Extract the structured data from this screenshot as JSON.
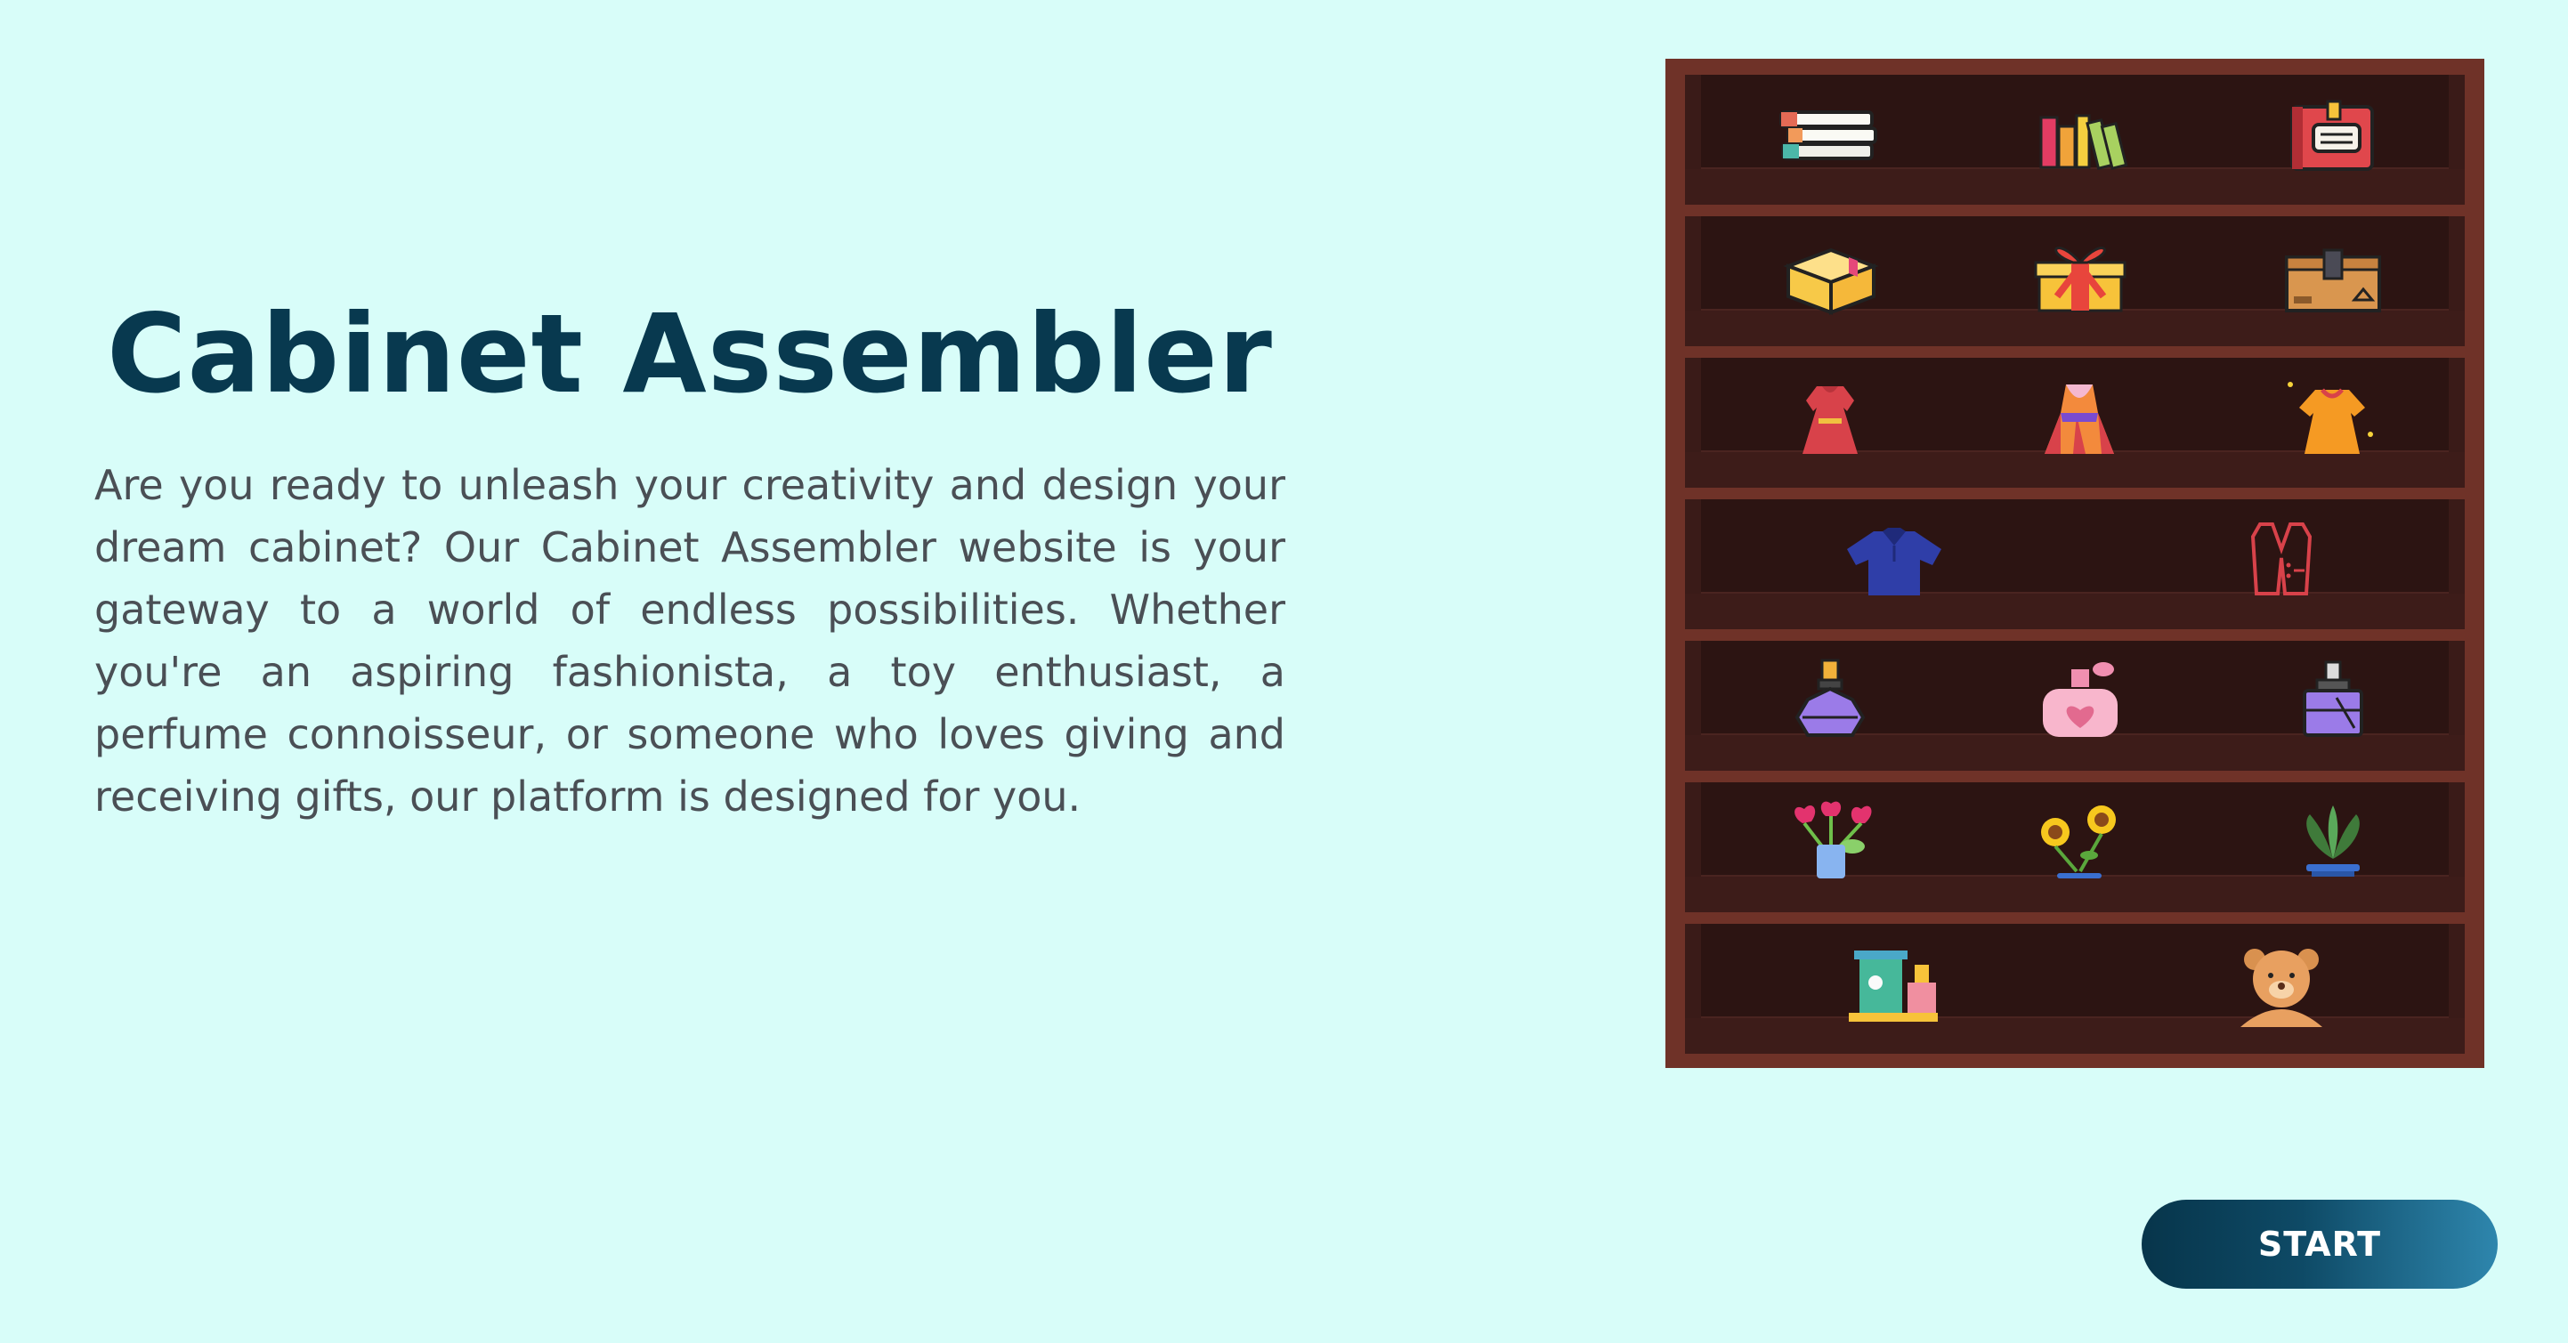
{
  "hero": {
    "title": "Cabinet Assembler",
    "description": "Are you ready to unleash your creativity and design your dream cabinet? Our Cabinet Assembler website is your gateway to a world of endless possibilities. Whether you're an aspiring fashionista, a toy enthusiast, a perfume connoisseur, or someone who loves giving and receiving gifts, our platform is designed for you."
  },
  "start_button": {
    "label": "START"
  },
  "colors": {
    "background": "#d8fdf9",
    "title": "#08394f",
    "cabinet_frame": "#6f3228",
    "cabinet_interior": "#2c1412",
    "button_gradient_start": "#07354b",
    "button_gradient_end": "#2e86ad"
  },
  "cabinet": {
    "shelves": [
      {
        "category": "books",
        "items": [
          "book-stack-icon",
          "books-upright-icon",
          "notebook-icon"
        ]
      },
      {
        "category": "boxes",
        "items": [
          "package-box-icon",
          "gift-box-icon",
          "cardboard-box-icon"
        ]
      },
      {
        "category": "dresses",
        "items": [
          "red-dress-icon",
          "striped-dress-icon",
          "orange-dress-icon"
        ]
      },
      {
        "category": "clothing",
        "items": [
          "polo-shirt-icon",
          "vest-icon"
        ]
      },
      {
        "category": "perfumes",
        "items": [
          "perfume-bottle-icon",
          "pink-perfume-icon",
          "purple-perfume-icon"
        ]
      },
      {
        "category": "plants",
        "items": [
          "tulip-vase-icon",
          "sunflower-icon",
          "potted-plant-icon"
        ]
      },
      {
        "category": "toys",
        "items": [
          "toy-train-icon",
          "teddy-bear-icon"
        ]
      }
    ]
  }
}
